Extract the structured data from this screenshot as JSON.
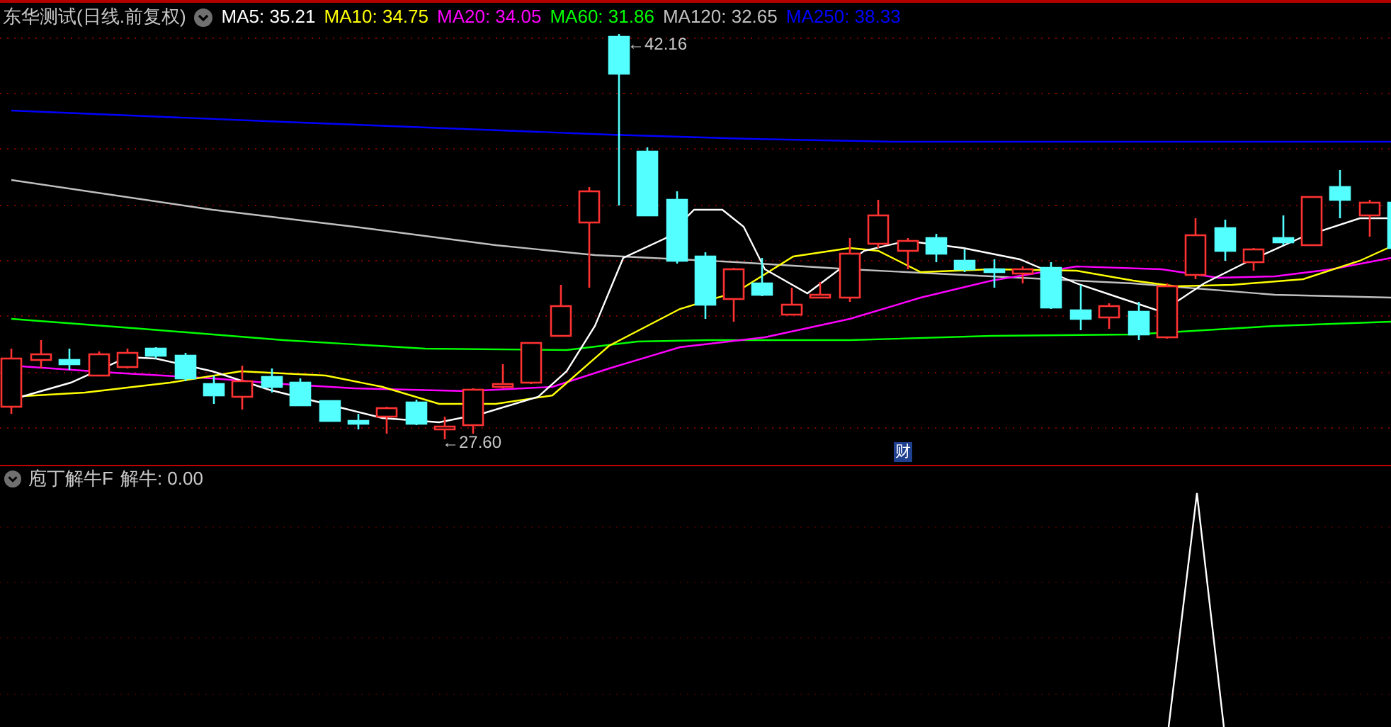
{
  "header": {
    "title": "东华测试(日线.前复权)",
    "legend": [
      {
        "text": "MA5: 35.21",
        "color": "#ffffff"
      },
      {
        "text": "MA10: 34.75",
        "color": "#ffff00"
      },
      {
        "text": "MA20: 34.05",
        "color": "#ff00ff"
      },
      {
        "text": "MA60: 31.86",
        "color": "#00ff00"
      },
      {
        "text": "MA120: 32.65",
        "color": "#c0c0c0"
      },
      {
        "text": "MA250: 38.33",
        "color": "#0000ff"
      }
    ]
  },
  "main_chart": {
    "high_label": "←42.16",
    "low_label": "←27.60",
    "badge": "财"
  },
  "indicator": {
    "name": "庖丁解牛F",
    "value": "解牛: 0.00"
  }
}
